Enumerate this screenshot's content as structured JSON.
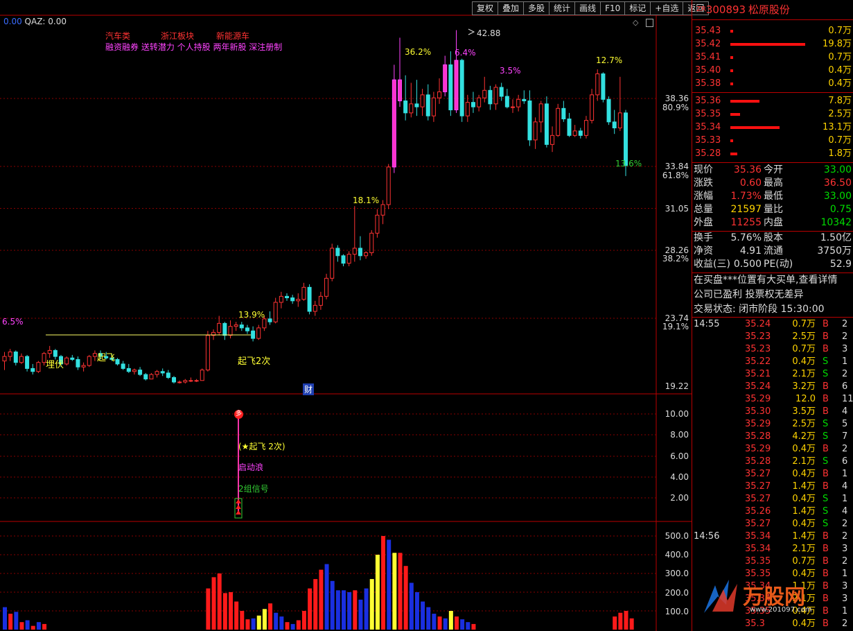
{
  "toolbar": [
    "复权",
    "叠加",
    "多股",
    "统计",
    "画线",
    "F10",
    "标记",
    "+自选",
    "返回"
  ],
  "indicator_header": {
    "value1": "0.00",
    "name": "QAZ:",
    "value2": "0.00"
  },
  "concepts": {
    "row1": [
      "汽车类",
      "浙江板块",
      "新能源车"
    ],
    "row2": "融资融券 送转潜力 个人持股 两年新股 深注册制"
  },
  "price_axis": [
    {
      "label": "38.36",
      "sub": "80.9%"
    },
    {
      "label": "33.84",
      "sub": "61.8%"
    },
    {
      "label": "31.05",
      "sub": ""
    },
    {
      "label": "28.26",
      "sub": "38.2%"
    },
    {
      "label": "23.74",
      "sub": "19.1%"
    },
    {
      "label": "19.22",
      "sub": ""
    }
  ],
  "chart_labels": {
    "high": "42.88",
    "pct_362": "36.2%",
    "pct_64": "6.4%",
    "pct_35": "3.5%",
    "pct_127": "12.7%",
    "pct_181": "18.1%",
    "pct_139": "13.9%",
    "pct_65": "6.5%",
    "pct_136": "13.6%",
    "liefu": "埋伏",
    "qifei": "起飞",
    "qifei2": "起飞2次",
    "cai": "财"
  },
  "signal_panel": {
    "axis": [
      "10.00",
      "8.00",
      "6.00",
      "4.00",
      "2.00"
    ],
    "badge": "多",
    "text1": "(★起飞 2次)",
    "text2": "启动浪",
    "text3": "2组信号"
  },
  "volume_axis": [
    "500.0",
    "400.0",
    "300.0",
    "200.0",
    "100.0"
  ],
  "stock": {
    "tag": "ZR",
    "code": "300893",
    "name": "松原股份"
  },
  "asks": [
    {
      "price": "35.43",
      "vol": "0.7万",
      "w": 4
    },
    {
      "price": "35.42",
      "vol": "19.8万",
      "w": 108
    },
    {
      "price": "35.41",
      "vol": "0.7万",
      "w": 4
    },
    {
      "price": "35.40",
      "vol": "0.4万",
      "w": 4
    },
    {
      "price": "35.38",
      "vol": "0.4万",
      "w": 4
    }
  ],
  "bids": [
    {
      "price": "35.36",
      "vol": "7.8万",
      "w": 42
    },
    {
      "price": "35.35",
      "vol": "2.5万",
      "w": 14
    },
    {
      "price": "35.34",
      "vol": "13.1万",
      "w": 71
    },
    {
      "price": "35.33",
      "vol": "0.7万",
      "w": 4
    },
    {
      "price": "35.28",
      "vol": "1.8万",
      "w": 10
    }
  ],
  "quote": [
    {
      "l1": "现价",
      "v1": "35.36",
      "c1": "#ff3333",
      "l2": "今开",
      "v2": "33.00",
      "c2": "#00dd00"
    },
    {
      "l1": "涨跌",
      "v1": "0.60",
      "c1": "#ff3333",
      "l2": "最高",
      "v2": "36.50",
      "c2": "#ff3333"
    },
    {
      "l1": "涨幅",
      "v1": "1.73%",
      "c1": "#ff3333",
      "l2": "最低",
      "v2": "33.00",
      "c2": "#00dd00"
    },
    {
      "l1": "总量",
      "v1": "21597",
      "c1": "#ffd400",
      "l2": "量比",
      "v2": "0.75",
      "c2": "#00dd00"
    },
    {
      "l1": "外盘",
      "v1": "11255",
      "c1": "#ff3333",
      "l2": "内盘",
      "v2": "10342",
      "c2": "#00dd00"
    }
  ],
  "quote2": [
    {
      "l1": "换手",
      "v1": "5.76%",
      "l2": "股本",
      "v2": "1.50亿"
    },
    {
      "l1": "净资",
      "v1": "4.91",
      "l2": "流通",
      "v2": "3750万"
    },
    {
      "l1": "收益(三)",
      "v1": "0.500",
      "l2": "PE(动)",
      "v2": "52.9"
    }
  ],
  "info": [
    "在买盘***位置有大买单,查看详情",
    "公司已盈利 投票权无差异"
  ],
  "status": {
    "label": "交易状态: 闭市阶段",
    "time": "15:30:00"
  },
  "ticks": [
    {
      "t": "14:55",
      "p": "35.24",
      "v": "0.7万",
      "s": "B",
      "n": "2"
    },
    {
      "t": "",
      "p": "35.23",
      "v": "2.5万",
      "s": "B",
      "n": "2"
    },
    {
      "t": "",
      "p": "35.23",
      "v": "0.7万",
      "s": "B",
      "n": "3"
    },
    {
      "t": "",
      "p": "35.22",
      "v": "0.4万",
      "s": "S",
      "n": "1"
    },
    {
      "t": "",
      "p": "35.21",
      "v": "2.1万",
      "s": "S",
      "n": "2"
    },
    {
      "t": "",
      "p": "35.24",
      "v": "3.2万",
      "s": "B",
      "n": "6"
    },
    {
      "t": "",
      "p": "35.29",
      "v": "12.0万",
      "s": "B",
      "n": "11"
    },
    {
      "t": "",
      "p": "35.30",
      "v": "3.5万",
      "s": "B",
      "n": "4"
    },
    {
      "t": "",
      "p": "35.29",
      "v": "2.5万",
      "s": "S",
      "n": "5"
    },
    {
      "t": "",
      "p": "35.28",
      "v": "4.2万",
      "s": "S",
      "n": "7"
    },
    {
      "t": "",
      "p": "35.29",
      "v": "0.4万",
      "s": "B",
      "n": "2"
    },
    {
      "t": "",
      "p": "35.28",
      "v": "2.1万",
      "s": "S",
      "n": "6"
    },
    {
      "t": "",
      "p": "35.27",
      "v": "0.4万",
      "s": "B",
      "n": "1"
    },
    {
      "t": "",
      "p": "35.27",
      "v": "1.4万",
      "s": "B",
      "n": "4"
    },
    {
      "t": "",
      "p": "35.27",
      "v": "0.4万",
      "s": "S",
      "n": "1"
    },
    {
      "t": "",
      "p": "35.26",
      "v": "1.4万",
      "s": "S",
      "n": "4"
    },
    {
      "t": "",
      "p": "35.27",
      "v": "0.4万",
      "s": "S",
      "n": "2"
    },
    {
      "t": "14:56",
      "p": "35.34",
      "v": "1.4万",
      "s": "B",
      "n": "2"
    },
    {
      "t": "",
      "p": "35.34",
      "v": "2.1万",
      "s": "B",
      "n": "3"
    },
    {
      "t": "",
      "p": "35.35",
      "v": "0.7万",
      "s": "B",
      "n": "2"
    },
    {
      "t": "",
      "p": "35.35",
      "v": "0.4万",
      "s": "B",
      "n": "1"
    },
    {
      "t": "",
      "p": "35.34",
      "v": "1.1万",
      "s": "B",
      "n": "3"
    },
    {
      "t": "",
      "p": "35.34",
      "v": "2.1万",
      "s": "B",
      "n": "3"
    },
    {
      "t": "",
      "p": "35.35",
      "v": "0.4万",
      "s": "B",
      "n": "1"
    },
    {
      "t": "",
      "p": "35.3",
      "v": "0.4万",
      "s": "B",
      "n": "2"
    }
  ],
  "watermark": "万股网",
  "watermark_url": "www.201097.com",
  "chart_data": {
    "type": "candlestick",
    "candles": [
      [
        20.9,
        21.5,
        20.3,
        21.2
      ],
      [
        21.2,
        21.7,
        20.9,
        21.5
      ],
      [
        21.5,
        21.6,
        20.6,
        20.8
      ],
      [
        20.8,
        21.4,
        20.7,
        21.2
      ],
      [
        21.2,
        21.3,
        20.2,
        20.4
      ],
      [
        20.4,
        20.7,
        20.0,
        20.2
      ],
      [
        20.2,
        20.9,
        20.1,
        20.8
      ],
      [
        20.8,
        21.5,
        20.6,
        21.4
      ],
      [
        21.4,
        21.9,
        21.1,
        21.6
      ],
      [
        21.6,
        21.7,
        21.0,
        21.2
      ],
      [
        21.2,
        21.3,
        20.5,
        20.7
      ],
      [
        20.7,
        21.2,
        20.6,
        21.1
      ],
      [
        21.1,
        21.3,
        20.9,
        21.0
      ],
      [
        21.0,
        21.2,
        20.3,
        20.5
      ],
      [
        20.5,
        20.8,
        20.2,
        20.6
      ],
      [
        20.6,
        21.3,
        20.5,
        21.2
      ],
      [
        21.2,
        21.6,
        20.9,
        21.4
      ],
      [
        21.4,
        21.6,
        21.0,
        21.2
      ],
      [
        21.2,
        21.5,
        21.0,
        21.1
      ],
      [
        21.1,
        21.4,
        20.9,
        21.0
      ],
      [
        21.0,
        21.1,
        20.6,
        20.7
      ],
      [
        20.7,
        20.9,
        20.3,
        20.4
      ],
      [
        20.4,
        20.7,
        20.1,
        20.2
      ],
      [
        20.2,
        20.4,
        20.0,
        20.3
      ],
      [
        20.3,
        20.5,
        19.9,
        20.0
      ],
      [
        20.0,
        20.1,
        19.6,
        19.7
      ],
      [
        19.7,
        20.1,
        19.7,
        20.0
      ],
      [
        20.0,
        20.3,
        19.8,
        20.2
      ],
      [
        20.2,
        20.4,
        19.9,
        20.1
      ],
      [
        20.1,
        20.3,
        19.7,
        19.8
      ],
      [
        19.8,
        19.9,
        19.4,
        19.5
      ],
      [
        19.5,
        19.6,
        19.4,
        19.5
      ],
      [
        19.5,
        19.7,
        19.4,
        19.6
      ],
      [
        19.6,
        19.8,
        19.5,
        19.6
      ],
      [
        19.6,
        19.7,
        19.5,
        19.6
      ],
      [
        19.6,
        20.4,
        19.6,
        20.3
      ],
      [
        20.3,
        22.9,
        20.2,
        22.6
      ],
      [
        22.6,
        23.0,
        22.3,
        22.8
      ],
      [
        22.8,
        23.9,
        22.6,
        23.4
      ],
      [
        23.4,
        23.5,
        22.3,
        22.6
      ],
      [
        22.6,
        23.6,
        22.4,
        23.2
      ],
      [
        23.2,
        23.5,
        22.9,
        23.3
      ],
      [
        23.3,
        23.5,
        22.9,
        23.1
      ],
      [
        23.1,
        23.3,
        22.7,
        22.9
      ],
      [
        22.9,
        23.2,
        22.2,
        22.4
      ],
      [
        22.4,
        23.3,
        22.3,
        23.1
      ],
      [
        23.1,
        23.9,
        22.9,
        23.7
      ],
      [
        23.7,
        24.2,
        23.3,
        23.5
      ],
      [
        23.5,
        25.1,
        23.4,
        24.8
      ],
      [
        24.8,
        25.5,
        24.4,
        25.2
      ],
      [
        25.2,
        25.4,
        24.9,
        25.1
      ],
      [
        25.1,
        25.3,
        24.7,
        24.9
      ],
      [
        24.9,
        25.4,
        24.5,
        25.0
      ],
      [
        25.0,
        26.1,
        24.9,
        25.8
      ],
      [
        25.8,
        26.0,
        24.0,
        24.2
      ],
      [
        24.2,
        24.9,
        23.9,
        24.6
      ],
      [
        24.6,
        25.5,
        24.3,
        25.2
      ],
      [
        25.2,
        26.7,
        25.0,
        26.4
      ],
      [
        26.4,
        28.7,
        26.2,
        28.4
      ],
      [
        28.4,
        28.6,
        27.5,
        27.9
      ],
      [
        27.9,
        28.0,
        27.2,
        27.4
      ],
      [
        27.4,
        28.2,
        27.2,
        28.0
      ],
      [
        28.0,
        31.2,
        27.5,
        28.4
      ],
      [
        28.4,
        29.2,
        27.6,
        27.9
      ],
      [
        27.9,
        28.2,
        27.7,
        28.1
      ],
      [
        28.1,
        29.6,
        27.9,
        29.4
      ],
      [
        29.4,
        31.0,
        29.1,
        30.6
      ],
      [
        30.6,
        31.6,
        30.0,
        31.3
      ],
      [
        31.3,
        34.0,
        31.0,
        33.8
      ],
      [
        33.8,
        40.6,
        33.4,
        39.6
      ],
      [
        39.6,
        42.4,
        37.8,
        38.2
      ],
      [
        38.2,
        39.9,
        36.9,
        37.4
      ],
      [
        37.4,
        39.4,
        37.1,
        38.0
      ],
      [
        38.0,
        39.6,
        37.2,
        37.8
      ],
      [
        37.8,
        39.0,
        37.2,
        38.6
      ],
      [
        38.6,
        39.3,
        36.9,
        37.2
      ],
      [
        37.2,
        38.8,
        36.8,
        38.4
      ],
      [
        38.4,
        39.7,
        38.0,
        38.8
      ],
      [
        38.8,
        41.2,
        38.5,
        40.6
      ],
      [
        40.6,
        41.5,
        37.2,
        37.6
      ],
      [
        37.6,
        42.9,
        37.4,
        40.9
      ],
      [
        40.9,
        41.0,
        36.8,
        37.2
      ],
      [
        37.2,
        38.6,
        36.8,
        38.1
      ],
      [
        38.1,
        38.8,
        37.4,
        37.8
      ],
      [
        37.8,
        38.6,
        37.5,
        38.4
      ],
      [
        38.4,
        39.8,
        38.1,
        38.9
      ],
      [
        38.9,
        39.2,
        37.6,
        38.0
      ],
      [
        38.0,
        39.3,
        37.6,
        39.1
      ],
      [
        39.1,
        39.4,
        38.2,
        38.5
      ],
      [
        38.5,
        39.0,
        37.7,
        37.8
      ],
      [
        37.8,
        38.3,
        37.4,
        37.8
      ],
      [
        37.8,
        38.6,
        37.5,
        38.3
      ],
      [
        38.3,
        38.9,
        38.0,
        38.2
      ],
      [
        38.2,
        38.9,
        35.2,
        35.6
      ],
      [
        35.6,
        37.1,
        35.0,
        36.8
      ],
      [
        36.8,
        38.2,
        36.1,
        38.0
      ],
      [
        38.0,
        38.5,
        35.1,
        35.3
      ],
      [
        35.3,
        36.5,
        34.8,
        35.9
      ],
      [
        35.9,
        38.0,
        35.8,
        37.7
      ],
      [
        37.7,
        38.2,
        36.8,
        37.0
      ],
      [
        37.0,
        37.4,
        35.8,
        35.9
      ],
      [
        35.9,
        36.6,
        35.8,
        36.2
      ],
      [
        36.2,
        36.4,
        35.7,
        35.9
      ],
      [
        35.9,
        37.2,
        35.7,
        36.9
      ],
      [
        36.9,
        39.0,
        36.7,
        38.6
      ],
      [
        38.6,
        40.3,
        38.2,
        40.0
      ],
      [
        40.0,
        40.1,
        38.1,
        38.3
      ],
      [
        38.3,
        38.5,
        36.6,
        36.8
      ],
      [
        36.8,
        37.6,
        36.0,
        36.4
      ],
      [
        36.4,
        39.8,
        36.2,
        37.4
      ],
      [
        37.4,
        37.6,
        33.2,
        33.9
      ]
    ],
    "volume": [
      [
        120,
        "blue"
      ],
      [
        85,
        "red"
      ],
      [
        95,
        "blue"
      ],
      [
        40,
        "red"
      ],
      [
        50,
        "blue"
      ],
      [
        20,
        "red"
      ],
      [
        40,
        "blue"
      ],
      [
        30,
        "red"
      ],
      [
        0,
        "blue"
      ],
      [
        0,
        "red"
      ],
      [
        0,
        "blue"
      ],
      [
        0,
        "red"
      ],
      [
        0,
        "blue"
      ],
      [
        0,
        "red"
      ],
      [
        0,
        "blue"
      ],
      [
        0,
        "red"
      ],
      [
        0,
        "blue"
      ],
      [
        0,
        "red"
      ],
      [
        0,
        "blue"
      ],
      [
        0,
        "red"
      ],
      [
        0,
        "blue"
      ],
      [
        0,
        "red"
      ],
      [
        0,
        "blue"
      ],
      [
        0,
        "red"
      ],
      [
        0,
        "blue"
      ],
      [
        0,
        "red"
      ],
      [
        0,
        "blue"
      ],
      [
        0,
        "red"
      ],
      [
        0,
        "blue"
      ],
      [
        0,
        "red"
      ],
      [
        0,
        "blue"
      ],
      [
        0,
        "red"
      ],
      [
        0,
        "blue"
      ],
      [
        0,
        "red"
      ],
      [
        0,
        "blue"
      ],
      [
        0,
        "red"
      ],
      [
        220,
        "red"
      ],
      [
        280,
        "red"
      ],
      [
        300,
        "red"
      ],
      [
        195,
        "red"
      ],
      [
        200,
        "red"
      ],
      [
        150,
        "red"
      ],
      [
        100,
        "red"
      ],
      [
        55,
        "red"
      ],
      [
        60,
        "blue"
      ],
      [
        75,
        "yellow"
      ],
      [
        110,
        "yellow"
      ],
      [
        140,
        "red"
      ],
      [
        90,
        "blue"
      ],
      [
        70,
        "blue"
      ],
      [
        40,
        "red"
      ],
      [
        30,
        "blue"
      ],
      [
        50,
        "red"
      ],
      [
        100,
        "red"
      ],
      [
        220,
        "red"
      ],
      [
        270,
        "red"
      ],
      [
        320,
        "red"
      ],
      [
        350,
        "blue"
      ],
      [
        260,
        "blue"
      ],
      [
        210,
        "blue"
      ],
      [
        210,
        "blue"
      ],
      [
        200,
        "blue"
      ],
      [
        210,
        "red"
      ],
      [
        160,
        "blue"
      ],
      [
        220,
        "blue"
      ],
      [
        270,
        "yellow"
      ],
      [
        400,
        "yellow"
      ],
      [
        500,
        "red"
      ],
      [
        480,
        "blue"
      ],
      [
        410,
        "yellow"
      ],
      [
        410,
        "red"
      ],
      [
        340,
        "red"
      ],
      [
        250,
        "blue"
      ],
      [
        200,
        "blue"
      ],
      [
        150,
        "blue"
      ],
      [
        120,
        "blue"
      ],
      [
        85,
        "blue"
      ],
      [
        70,
        "red"
      ],
      [
        60,
        "blue"
      ],
      [
        100,
        "yellow"
      ],
      [
        70,
        "red"
      ],
      [
        55,
        "blue"
      ],
      [
        40,
        "blue"
      ],
      [
        30,
        "red"
      ],
      [
        0,
        "blue"
      ],
      [
        0,
        "red"
      ],
      [
        0,
        "blue"
      ],
      [
        0,
        "red"
      ],
      [
        0,
        "blue"
      ],
      [
        0,
        "red"
      ],
      [
        0,
        "blue"
      ],
      [
        0,
        "red"
      ],
      [
        0,
        "blue"
      ],
      [
        0,
        "red"
      ],
      [
        0,
        "blue"
      ],
      [
        0,
        "red"
      ],
      [
        0,
        "blue"
      ],
      [
        0,
        "red"
      ],
      [
        0,
        "blue"
      ],
      [
        0,
        "red"
      ],
      [
        0,
        "blue"
      ],
      [
        0,
        "red"
      ],
      [
        0,
        "blue"
      ],
      [
        0,
        "red"
      ],
      [
        0,
        "blue"
      ],
      [
        0,
        "red"
      ],
      [
        0,
        "blue"
      ],
      [
        0,
        "red"
      ],
      [
        70,
        "red"
      ],
      [
        90,
        "red"
      ],
      [
        100,
        "red"
      ],
      [
        60,
        "red"
      ]
    ]
  }
}
